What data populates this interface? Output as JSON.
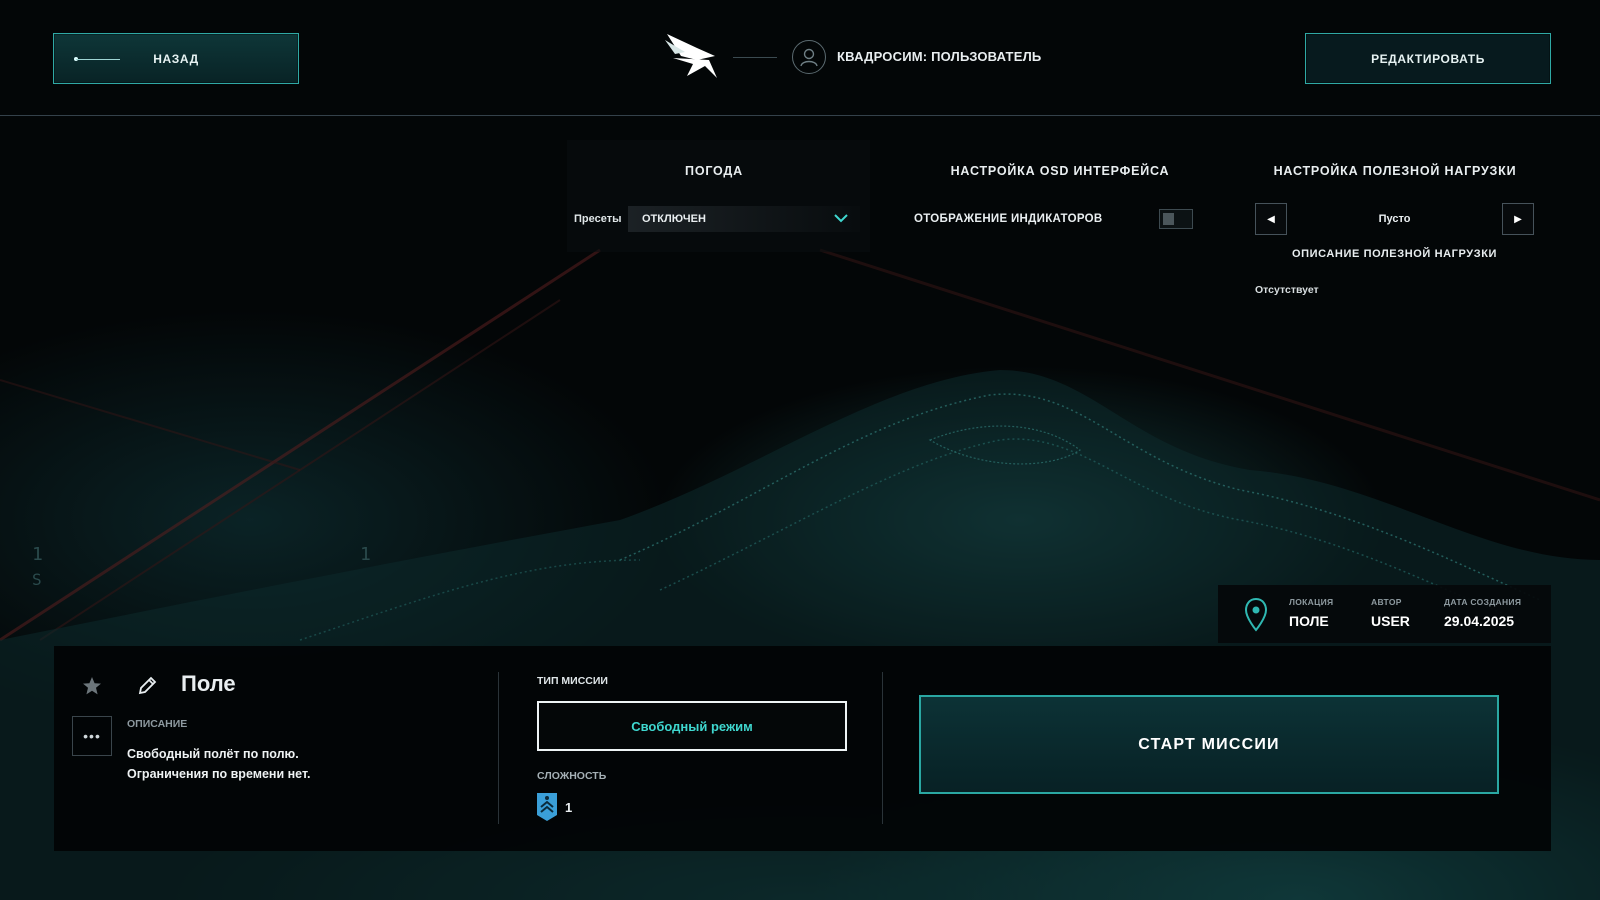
{
  "header": {
    "back_label": "НАЗАД",
    "user_label": "КВАДРОСИМ: ПОЛЬЗОВАТЕЛЬ",
    "edit_label": "РЕДАКТИРОВАТЬ"
  },
  "weather": {
    "title": "ПОГОДА",
    "presets_label": "Пресеты",
    "preset_value": "ОТКЛЮЧЕН"
  },
  "osd": {
    "title": "НАСТРОЙКА OSD ИНТЕРФЕЙСА",
    "indicators_label": "ОТОБРАЖЕНИЕ ИНДИКАТОРОВ",
    "indicators_enabled": false
  },
  "payload": {
    "title": "НАСТРОЙКА ПОЛЕЗНОЙ НАГРУЗКИ",
    "value": "Пусто",
    "description_title": "ОПИСАНИЕ ПОЛЕЗНОЙ НАГРУЗКИ",
    "description": "Отсутствует"
  },
  "info": {
    "location_label": "ЛОКАЦИЯ",
    "location_value": "ПОЛЕ",
    "author_label": "АВТОР",
    "author_value": "USER",
    "date_label": "ДАТА СОЗДАНИЯ",
    "date_value": "29.04.2025"
  },
  "mission": {
    "name": "Поле",
    "description_label": "ОПИСАНИЕ",
    "description_line1": "Свободный полёт по полю.",
    "description_line2": "Ограничения по времени нет.",
    "type_label": "ТИП МИССИИ",
    "type_value": "Свободный режим",
    "difficulty_label": "СЛОЖНОСТЬ",
    "difficulty_value": "1",
    "start_label": "СТАРТ МИССИИ"
  },
  "colors": {
    "accent": "#2fa9a5",
    "accent_text": "#3fd7cf",
    "difficulty_badge": "#3a9fd8"
  },
  "icons": [
    "logo-icon",
    "user-avatar-icon",
    "chevron-down-icon",
    "arrow-left-icon",
    "arrow-right-icon",
    "location-pin-icon",
    "star-icon",
    "pencil-icon",
    "more-icon",
    "difficulty-badge-icon"
  ]
}
